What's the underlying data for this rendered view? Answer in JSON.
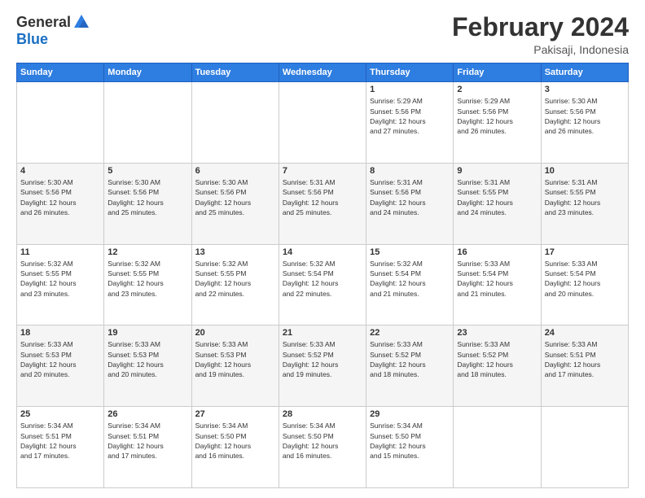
{
  "logo": {
    "general": "General",
    "blue": "Blue"
  },
  "title": "February 2024",
  "location": "Pakisaji, Indonesia",
  "days_header": [
    "Sunday",
    "Monday",
    "Tuesday",
    "Wednesday",
    "Thursday",
    "Friday",
    "Saturday"
  ],
  "weeks": [
    [
      {
        "day": "",
        "info": ""
      },
      {
        "day": "",
        "info": ""
      },
      {
        "day": "",
        "info": ""
      },
      {
        "day": "",
        "info": ""
      },
      {
        "day": "1",
        "info": "Sunrise: 5:29 AM\nSunset: 5:56 PM\nDaylight: 12 hours\nand 27 minutes."
      },
      {
        "day": "2",
        "info": "Sunrise: 5:29 AM\nSunset: 5:56 PM\nDaylight: 12 hours\nand 26 minutes."
      },
      {
        "day": "3",
        "info": "Sunrise: 5:30 AM\nSunset: 5:56 PM\nDaylight: 12 hours\nand 26 minutes."
      }
    ],
    [
      {
        "day": "4",
        "info": "Sunrise: 5:30 AM\nSunset: 5:56 PM\nDaylight: 12 hours\nand 26 minutes."
      },
      {
        "day": "5",
        "info": "Sunrise: 5:30 AM\nSunset: 5:56 PM\nDaylight: 12 hours\nand 25 minutes."
      },
      {
        "day": "6",
        "info": "Sunrise: 5:30 AM\nSunset: 5:56 PM\nDaylight: 12 hours\nand 25 minutes."
      },
      {
        "day": "7",
        "info": "Sunrise: 5:31 AM\nSunset: 5:56 PM\nDaylight: 12 hours\nand 25 minutes."
      },
      {
        "day": "8",
        "info": "Sunrise: 5:31 AM\nSunset: 5:56 PM\nDaylight: 12 hours\nand 24 minutes."
      },
      {
        "day": "9",
        "info": "Sunrise: 5:31 AM\nSunset: 5:55 PM\nDaylight: 12 hours\nand 24 minutes."
      },
      {
        "day": "10",
        "info": "Sunrise: 5:31 AM\nSunset: 5:55 PM\nDaylight: 12 hours\nand 23 minutes."
      }
    ],
    [
      {
        "day": "11",
        "info": "Sunrise: 5:32 AM\nSunset: 5:55 PM\nDaylight: 12 hours\nand 23 minutes."
      },
      {
        "day": "12",
        "info": "Sunrise: 5:32 AM\nSunset: 5:55 PM\nDaylight: 12 hours\nand 23 minutes."
      },
      {
        "day": "13",
        "info": "Sunrise: 5:32 AM\nSunset: 5:55 PM\nDaylight: 12 hours\nand 22 minutes."
      },
      {
        "day": "14",
        "info": "Sunrise: 5:32 AM\nSunset: 5:54 PM\nDaylight: 12 hours\nand 22 minutes."
      },
      {
        "day": "15",
        "info": "Sunrise: 5:32 AM\nSunset: 5:54 PM\nDaylight: 12 hours\nand 21 minutes."
      },
      {
        "day": "16",
        "info": "Sunrise: 5:33 AM\nSunset: 5:54 PM\nDaylight: 12 hours\nand 21 minutes."
      },
      {
        "day": "17",
        "info": "Sunrise: 5:33 AM\nSunset: 5:54 PM\nDaylight: 12 hours\nand 20 minutes."
      }
    ],
    [
      {
        "day": "18",
        "info": "Sunrise: 5:33 AM\nSunset: 5:53 PM\nDaylight: 12 hours\nand 20 minutes."
      },
      {
        "day": "19",
        "info": "Sunrise: 5:33 AM\nSunset: 5:53 PM\nDaylight: 12 hours\nand 20 minutes."
      },
      {
        "day": "20",
        "info": "Sunrise: 5:33 AM\nSunset: 5:53 PM\nDaylight: 12 hours\nand 19 minutes."
      },
      {
        "day": "21",
        "info": "Sunrise: 5:33 AM\nSunset: 5:52 PM\nDaylight: 12 hours\nand 19 minutes."
      },
      {
        "day": "22",
        "info": "Sunrise: 5:33 AM\nSunset: 5:52 PM\nDaylight: 12 hours\nand 18 minutes."
      },
      {
        "day": "23",
        "info": "Sunrise: 5:33 AM\nSunset: 5:52 PM\nDaylight: 12 hours\nand 18 minutes."
      },
      {
        "day": "24",
        "info": "Sunrise: 5:33 AM\nSunset: 5:51 PM\nDaylight: 12 hours\nand 17 minutes."
      }
    ],
    [
      {
        "day": "25",
        "info": "Sunrise: 5:34 AM\nSunset: 5:51 PM\nDaylight: 12 hours\nand 17 minutes."
      },
      {
        "day": "26",
        "info": "Sunrise: 5:34 AM\nSunset: 5:51 PM\nDaylight: 12 hours\nand 17 minutes."
      },
      {
        "day": "27",
        "info": "Sunrise: 5:34 AM\nSunset: 5:50 PM\nDaylight: 12 hours\nand 16 minutes."
      },
      {
        "day": "28",
        "info": "Sunrise: 5:34 AM\nSunset: 5:50 PM\nDaylight: 12 hours\nand 16 minutes."
      },
      {
        "day": "29",
        "info": "Sunrise: 5:34 AM\nSunset: 5:50 PM\nDaylight: 12 hours\nand 15 minutes."
      },
      {
        "day": "",
        "info": ""
      },
      {
        "day": "",
        "info": ""
      }
    ]
  ]
}
